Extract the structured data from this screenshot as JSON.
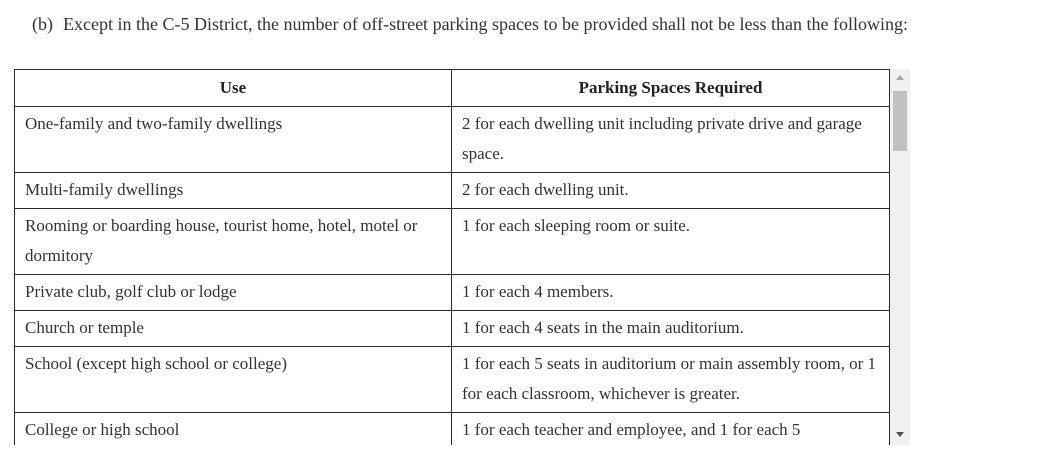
{
  "intro": {
    "marker": "(b)",
    "text": "Except in the C-5 District, the number of off-street parking spaces to be provided shall not be less than the following:"
  },
  "table": {
    "headers": [
      "Use",
      "Parking Spaces Required"
    ],
    "rows": [
      [
        "One-family and two-family dwellings",
        "2 for each dwelling unit including private drive and garage space."
      ],
      [
        "Multi-family dwellings",
        "2 for each dwelling unit."
      ],
      [
        "Rooming or boarding house, tourist home, hotel, motel or dormitory",
        "1 for each sleeping room or suite."
      ],
      [
        "Private club, golf club or lodge",
        "1 for each 4 members."
      ],
      [
        "Church or temple",
        "1 for each 4 seats in the main auditorium."
      ],
      [
        "School (except high school or college)",
        "1 for each 5 seats in auditorium or main assembly room, or 1 for each classroom, whichever is greater."
      ],
      [
        "College or high school",
        "1 for each teacher and employee, and 1 for each 5"
      ]
    ]
  },
  "scrollbar": {
    "up_icon": "chevron-up-icon",
    "down_icon": "chevron-down-icon"
  }
}
